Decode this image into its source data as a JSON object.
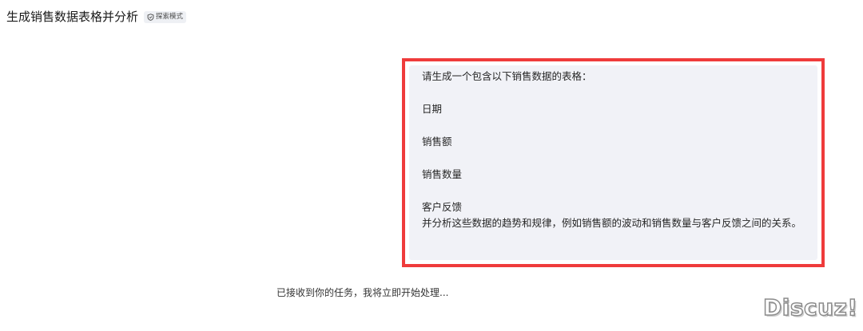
{
  "header": {
    "title": "生成销售数据表格并分析",
    "badge": {
      "icon": "shield-icon",
      "label": "探索模式"
    }
  },
  "user_message": {
    "lines": [
      "请生成一个包含以下销售数据的表格：",
      "日期",
      "销售额",
      "销售数量",
      "客户反馈",
      "并分析这些数据的趋势和规律，例如销售额的波动和销售数量与客户反馈之间的关系。"
    ],
    "highlight_color": "#ef3b3b",
    "bubble_color": "#f1f2f7"
  },
  "assistant_status": "已接收到你的任务，我将立即开始处理...",
  "watermark": "Discuz!"
}
